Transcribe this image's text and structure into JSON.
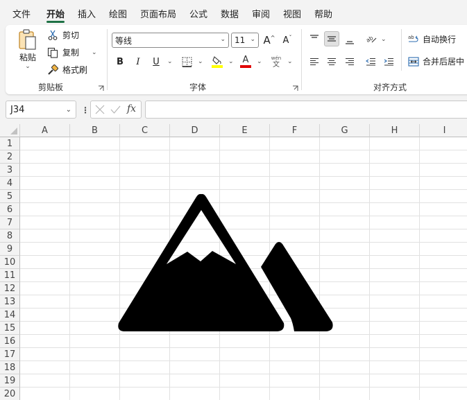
{
  "tabs": [
    {
      "label": "文件",
      "active": false
    },
    {
      "label": "开始",
      "active": true
    },
    {
      "label": "插入",
      "active": false
    },
    {
      "label": "绘图",
      "active": false
    },
    {
      "label": "页面布局",
      "active": false
    },
    {
      "label": "公式",
      "active": false
    },
    {
      "label": "数据",
      "active": false
    },
    {
      "label": "审阅",
      "active": false
    },
    {
      "label": "视图",
      "active": false
    },
    {
      "label": "帮助",
      "active": false
    }
  ],
  "ribbon": {
    "clipboard": {
      "group_label": "剪贴板",
      "paste_label": "粘贴",
      "cut_label": "剪切",
      "copy_label": "复制",
      "format_painter_label": "格式刷"
    },
    "font": {
      "group_label": "字体",
      "font_name": "等线",
      "font_size": "11",
      "bold": "B",
      "italic": "I",
      "underline": "U",
      "grow": "A",
      "shrink": "A",
      "font_color_letter": "A",
      "phonetic_top": "wén",
      "phonetic_bottom": "文",
      "highlight_color": "#ffff00",
      "font_color": "#e00000"
    },
    "alignment": {
      "group_label": "对齐方式",
      "wrap_text_label": "自动换行",
      "merge_center_label": "合并后居中"
    }
  },
  "formula_bar": {
    "name_box": "J34",
    "fx_label": "fx",
    "formula": ""
  },
  "sheet": {
    "columns": [
      "A",
      "B",
      "C",
      "D",
      "E",
      "F",
      "G",
      "H",
      "I"
    ],
    "rows": [
      "1",
      "2",
      "3",
      "4",
      "5",
      "6",
      "7",
      "8",
      "9",
      "10",
      "11",
      "12",
      "13",
      "14",
      "15",
      "16",
      "17",
      "18",
      "19",
      "20"
    ],
    "inserted_graphic": "mountain-icon"
  },
  "colors": {
    "accent": "#1e7145",
    "ribbon_bg": "#ffffff",
    "window_bg": "#f3f3f3",
    "gridline": "#e1e1e1"
  }
}
